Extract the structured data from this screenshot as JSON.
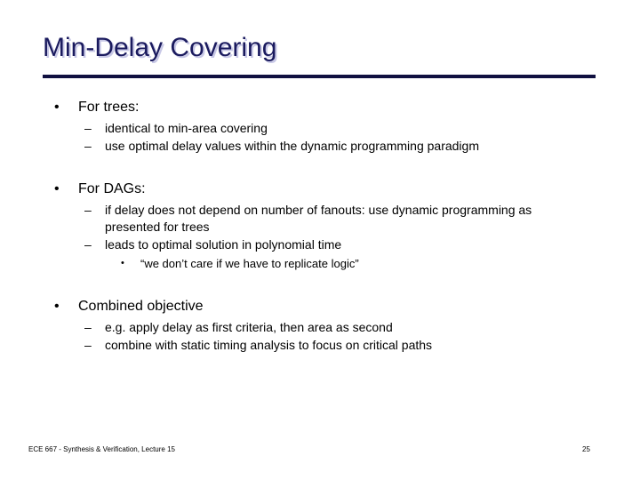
{
  "slide": {
    "title": "Min-Delay Covering",
    "title_color": "#1a1a5e",
    "rule_color": "#101040",
    "background_color": "#ffffff",
    "bullet_glyph": "•",
    "dash_glyph": "–",
    "sub_bullet_glyph": "•",
    "groups": [
      {
        "heading": "For trees:",
        "items": [
          "identical to min-area covering",
          "use optimal delay values within the dynamic programming paradigm"
        ],
        "subitems": []
      },
      {
        "heading": "For DAGs:",
        "items": [
          "if delay does not depend on number of fanouts: use dynamic programming as presented for trees",
          "leads to optimal solution in polynomial time"
        ],
        "subitems": [
          "“we don’t care if we have to replicate logic”"
        ]
      },
      {
        "heading": "Combined objective",
        "items": [
          "e.g. apply delay as first criteria, then area as second",
          "combine with static timing analysis to focus on critical paths"
        ],
        "subitems": []
      }
    ]
  },
  "footer": {
    "course": "ECE 667 - Synthesis & Verification, Lecture 15",
    "page_number": "25"
  }
}
